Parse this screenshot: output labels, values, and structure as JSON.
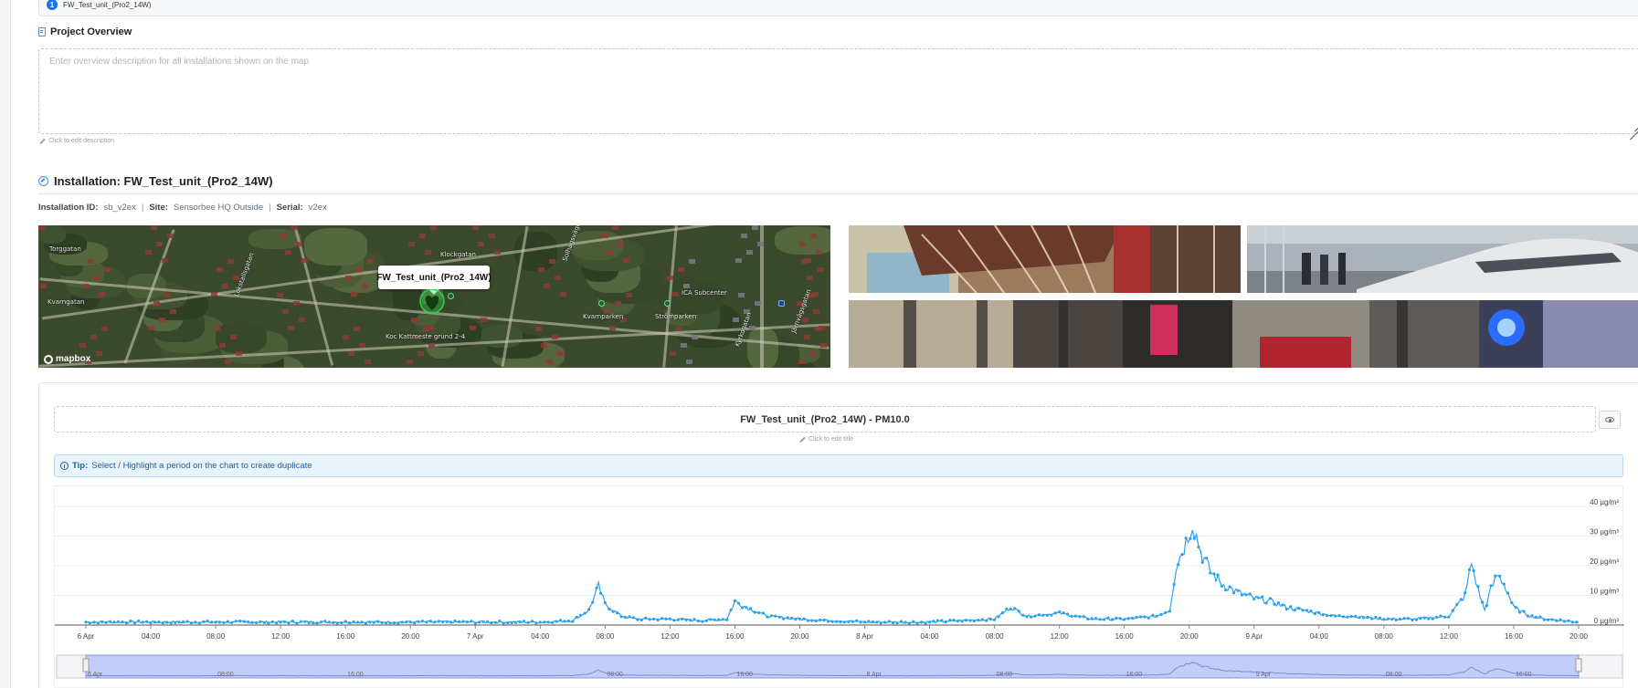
{
  "top_chip": {
    "number": "1",
    "label": "FW_Test_unit_(Pro2_14W)"
  },
  "project_overview": {
    "title": "Project Overview",
    "placeholder": "Enter overview description for all installations shown on the map",
    "edit_hint": "Click to edit description"
  },
  "installation": {
    "title": "Installation: FW_Test_unit_(Pro2_14W)",
    "id_label": "Installation ID:",
    "id_value": "sb_v2ex",
    "site_label": "Site:",
    "site_value": "Sensorbee HQ Outside",
    "serial_label": "Serial:",
    "serial_value": "v2ex",
    "separator": "|"
  },
  "map": {
    "popup_label": "FW_Test_unit_(Pro2_14W)",
    "attribution": "mapbox",
    "labels": [
      "Torggatan",
      "Kvarngatan",
      "Lokstallsgatan",
      "Solhagsvägen",
      "Kvarnparken",
      "Strömparken",
      "ICA Subcenter",
      "Kyrkogatan",
      "Järnvägsgatan",
      "Klockgatan",
      "Koc Kattmeste grund 2-4"
    ],
    "accent_color": "#2fd14a"
  },
  "chart": {
    "title": "FW_Test_unit_(Pro2_14W) - PM10.0",
    "edit_hint": "Click to edit title",
    "tip_label": "Tip:",
    "tip_text": "Select / Highlight a period on the chart to create duplicate",
    "eye_icon": "eye-icon"
  },
  "chart_data": {
    "type": "line",
    "title": "FW_Test_unit_(Pro2_14W) - PM10.0",
    "x_ticks": [
      "6 Apr",
      "04:00",
      "08:00",
      "12:00",
      "16:00",
      "20:00",
      "7 Apr",
      "04:00",
      "08:00",
      "12:00",
      "16:00",
      "20:00",
      "8 Apr",
      "04:00",
      "08:00",
      "12:00",
      "16:00",
      "20:00",
      "9 Apr",
      "04:00",
      "08:00",
      "12:00",
      "16:00",
      "20:00"
    ],
    "y_ticks": [
      "40 µg/m³",
      "30 µg/m³",
      "20 µg/m³",
      "10 µg/m³",
      "0 µg/m³"
    ],
    "ylim": [
      0,
      40
    ],
    "x_unit": "hours since 6 Apr 00:00",
    "xlim": [
      0,
      92
    ],
    "navigator_ticks": [
      "6 Apr",
      "08:00",
      "16:00",
      "08:00",
      "16:00",
      "8 Apr",
      "08:00",
      "16:00",
      "9 Apr",
      "08:00",
      "16:00"
    ],
    "series": [
      {
        "name": "PM10.0",
        "color": "#2aa1ee",
        "points": [
          [
            0,
            1
          ],
          [
            4,
            1
          ],
          [
            8,
            1
          ],
          [
            12,
            1
          ],
          [
            16,
            1
          ],
          [
            20,
            1
          ],
          [
            24,
            1
          ],
          [
            28,
            1
          ],
          [
            30,
            1.5
          ],
          [
            31,
            5
          ],
          [
            31.6,
            13
          ],
          [
            32,
            7
          ],
          [
            33,
            3
          ],
          [
            34,
            2
          ],
          [
            36,
            2
          ],
          [
            38,
            1.5
          ],
          [
            39.5,
            2
          ],
          [
            40,
            8
          ],
          [
            40.7,
            6
          ],
          [
            42,
            3
          ],
          [
            44,
            2
          ],
          [
            46,
            1.5
          ],
          [
            48,
            1
          ],
          [
            52,
            1
          ],
          [
            54,
            1.5
          ],
          [
            56,
            2
          ],
          [
            57,
            6
          ],
          [
            58,
            3
          ],
          [
            60,
            4
          ],
          [
            61,
            3
          ],
          [
            62,
            2
          ],
          [
            64,
            2
          ],
          [
            66,
            3
          ],
          [
            66.8,
            5
          ],
          [
            67.2,
            20
          ],
          [
            67.8,
            28
          ],
          [
            68.2,
            35
          ],
          [
            68.7,
            25
          ],
          [
            69.3,
            18
          ],
          [
            70,
            14
          ],
          [
            71,
            11
          ],
          [
            72,
            9
          ],
          [
            73,
            8
          ],
          [
            74,
            6
          ],
          [
            75,
            5
          ],
          [
            76,
            4
          ],
          [
            77,
            3
          ],
          [
            78,
            3
          ],
          [
            80,
            2
          ],
          [
            82,
            2
          ],
          [
            84,
            3
          ],
          [
            85,
            10
          ],
          [
            85.4,
            21
          ],
          [
            85.8,
            12
          ],
          [
            86.2,
            5
          ],
          [
            86.6,
            12
          ],
          [
            87,
            17
          ],
          [
            87.4,
            14
          ],
          [
            88,
            6
          ],
          [
            89,
            3
          ],
          [
            90,
            2
          ],
          [
            91,
            1.5
          ],
          [
            92,
            1
          ]
        ]
      }
    ]
  }
}
